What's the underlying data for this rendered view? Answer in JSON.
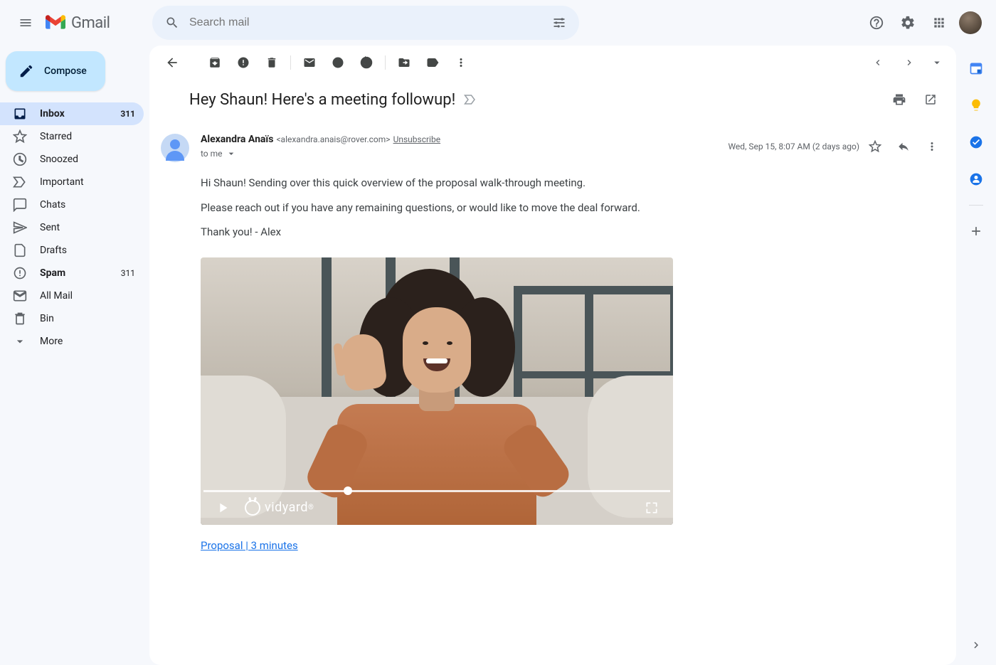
{
  "header": {
    "app_name": "Gmail",
    "search_placeholder": "Search mail"
  },
  "compose_label": "Compose",
  "nav": [
    {
      "icon": "inbox",
      "label": "Inbox",
      "count": "311",
      "active": true,
      "bold": true
    },
    {
      "icon": "star",
      "label": "Starred"
    },
    {
      "icon": "clock",
      "label": "Snoozed"
    },
    {
      "icon": "important",
      "label": "Important"
    },
    {
      "icon": "chat",
      "label": "Chats"
    },
    {
      "icon": "send",
      "label": "Sent"
    },
    {
      "icon": "draft",
      "label": "Drafts"
    },
    {
      "icon": "spam",
      "label": "Spam",
      "count": "311",
      "bold": true
    },
    {
      "icon": "mail",
      "label": "All Mail"
    },
    {
      "icon": "trash",
      "label": "Bin"
    },
    {
      "icon": "more",
      "label": "More"
    }
  ],
  "message": {
    "subject": "Hey Shaun! Here's a meeting followup!",
    "sender_name": "Alexandra Anaïs",
    "sender_email": "<alexandra.anais@rover.com>",
    "unsubscribe": "Unsubscribe",
    "to_line": "to me",
    "timestamp": "Wed, Sep 15, 8:07 AM (2 days ago)",
    "body_p1": "Hi Shaun! Sending over this quick overview of the proposal walk-through meeting.",
    "body_p2": "Please reach out if you have any remaining questions, or would like to move the deal forward.",
    "body_p3": "Thank you! - Alex",
    "video_brand": "vidyard",
    "video_link_text": "Proposal | 3 minutes"
  }
}
